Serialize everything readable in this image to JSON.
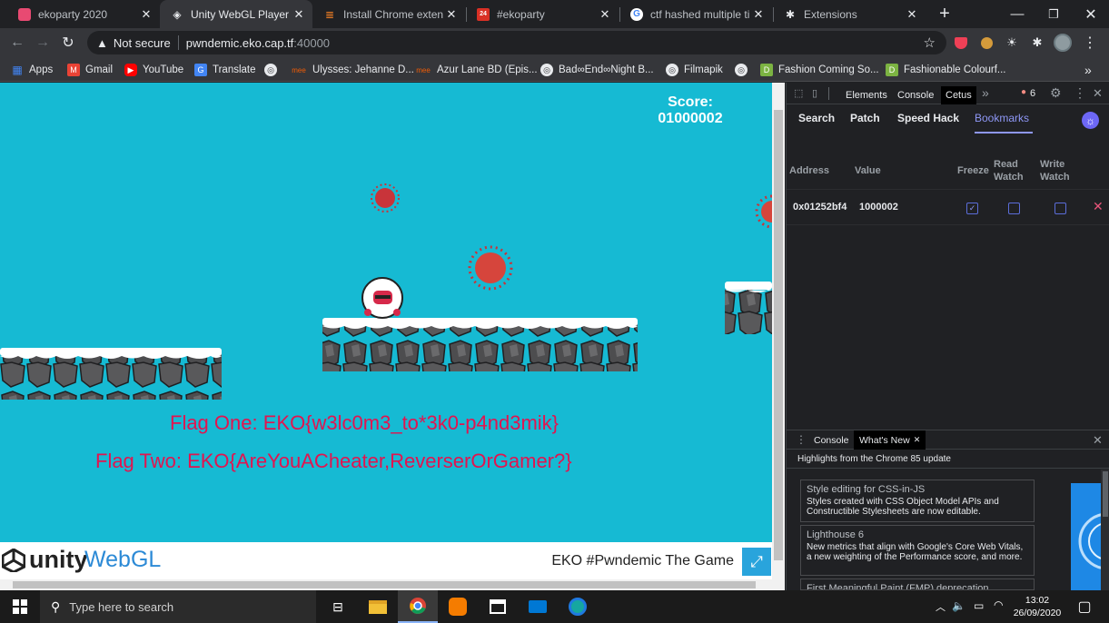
{
  "tabs": [
    {
      "title": "ekoparty 2020",
      "icon": "ekoparty-icon",
      "active": false
    },
    {
      "title": "Unity WebGL Player | EK",
      "icon": "unity-icon",
      "active": true
    },
    {
      "title": "Install Chrome extension",
      "icon": "stackoverflow-icon",
      "active": false
    },
    {
      "title": "#ekoparty",
      "icon": "calendar-icon",
      "active": false
    },
    {
      "title": "ctf hashed multiple time",
      "icon": "google-icon",
      "active": false
    },
    {
      "title": "Extensions",
      "icon": "puzzle-icon",
      "active": false
    }
  ],
  "toolbar": {
    "security": "Not secure",
    "url_host": "pwndemic.eko.cap.tf",
    "url_port": ":40000"
  },
  "bookmarks": [
    {
      "label": "Apps",
      "icon": "apps-grid-icon",
      "color": "#4285f4"
    },
    {
      "label": "Gmail",
      "icon": "gmail-icon",
      "color": "#ea4335"
    },
    {
      "label": "YouTube",
      "icon": "youtube-icon",
      "color": "#ff0000"
    },
    {
      "label": "Translate",
      "icon": "translate-icon",
      "color": "#4285f4"
    },
    {
      "label": "",
      "icon": "globe-icon",
      "color": "#e8eaed"
    },
    {
      "label": "Ulysses: Jehanne D...",
      "icon": "mee-icon",
      "color": "#f25c05"
    },
    {
      "label": "Azur Lane BD (Epis...",
      "icon": "mee-icon",
      "color": "#f25c05"
    },
    {
      "label": "Bad∞End∞Night B...",
      "icon": "globe-icon",
      "color": "#e8eaed"
    },
    {
      "label": "Filmapik",
      "icon": "globe-icon",
      "color": "#e8eaed"
    },
    {
      "label": "",
      "icon": "globe-icon",
      "color": "#e8eaed"
    },
    {
      "label": "Fashion Coming So...",
      "icon": "bookmark-green-icon",
      "color": "#7cb342"
    },
    {
      "label": "Fashionable Colourf...",
      "icon": "bookmark-green-icon",
      "color": "#7cb342"
    }
  ],
  "game": {
    "score_label": "Score:",
    "score_value": "01000002",
    "flag_one": "Flag One: EKO{w3lc0m3_to*3k0-p4nd3mik}",
    "flag_two": "Flag Two: EKO{AreYouACheater,ReverserOrGamer?}",
    "bg_color": "#16bad3",
    "flag_color": "#e2144f"
  },
  "unity_footer": {
    "logo_word": "unity",
    "logo_suffix": "WebGL",
    "game_title": "EKO #Pwndemic The Game"
  },
  "devtools": {
    "tabs": [
      "Elements",
      "Console",
      "Cetus"
    ],
    "error_count": "6",
    "cetus_tabs": [
      "Search",
      "Patch",
      "Speed Hack",
      "Bookmarks"
    ],
    "columns": {
      "address": "Address",
      "value": "Value",
      "freeze": "Freeze",
      "read_watch": "Read Watch",
      "write_watch": "Write Watch"
    },
    "rows": [
      {
        "address": "0x01252bf4",
        "value": "1000002",
        "freeze": true,
        "read_watch": false,
        "write_watch": false
      }
    ],
    "drawer": {
      "tabs": [
        "Console",
        "What's New"
      ],
      "headline": "Highlights from the Chrome 85 update",
      "cards": [
        {
          "title": "Style editing for CSS-in-JS",
          "desc": "Styles created with CSS Object Model APIs and Constructible Stylesheets are now editable."
        },
        {
          "title": "Lighthouse 6",
          "desc": "New metrics that align with Google's Core Web Vitals, a new weighting of the Performance score, and more."
        },
        {
          "title": "First Meaningful Paint (FMP) deprecation",
          "desc": ""
        }
      ]
    }
  },
  "taskbar": {
    "search_placeholder": "Type here to search",
    "time": "13:02",
    "date": "26/09/2020"
  }
}
